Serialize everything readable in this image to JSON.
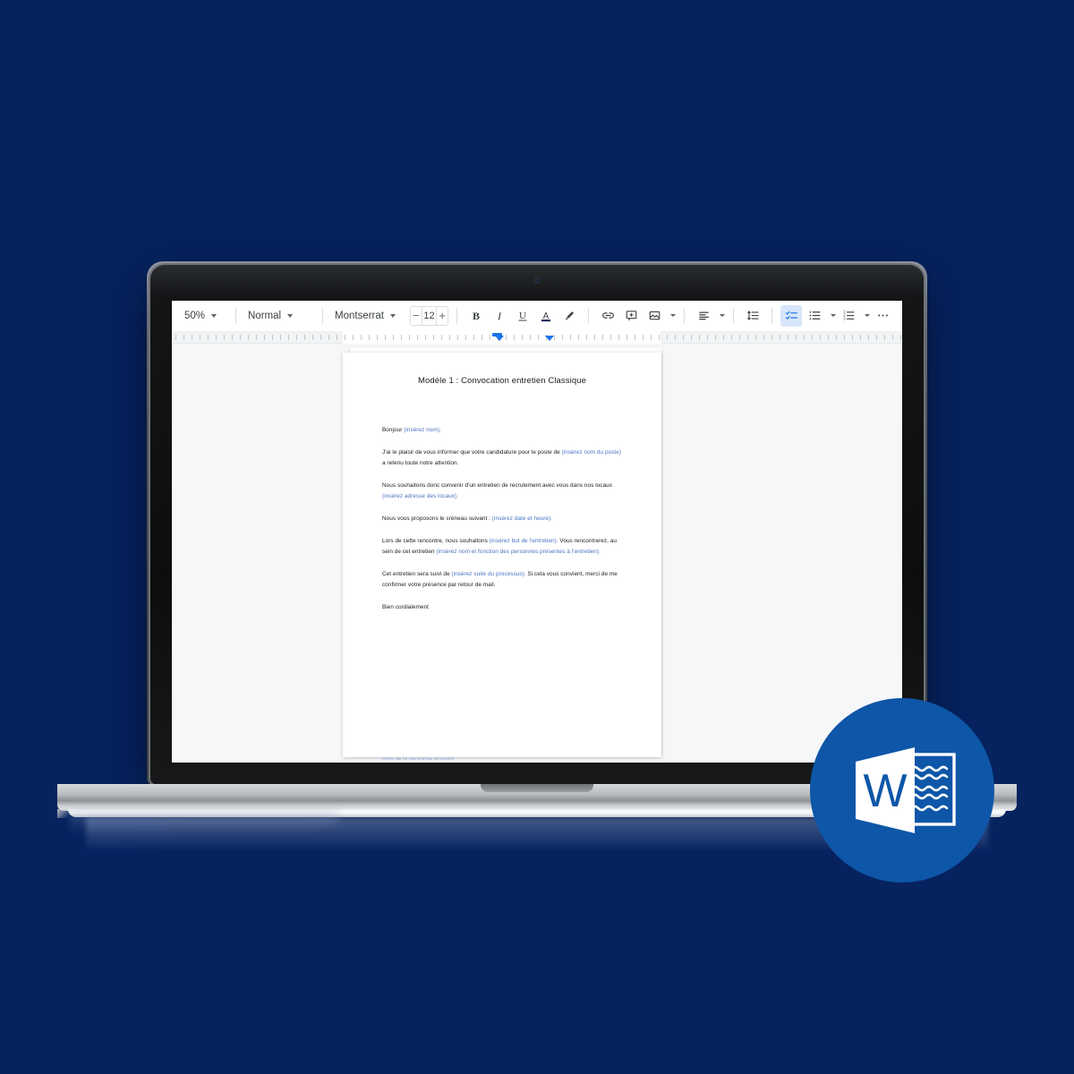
{
  "theme": {
    "background_color": "#06225f",
    "badge_color": "#0e56a8",
    "accent_color": "#1a73e8",
    "placeholder_text_color": "#4a72c4"
  },
  "device": {
    "name": "laptop-mockup",
    "webcam": "webcam-icon"
  },
  "toolbar": {
    "zoom_level": "50%",
    "paragraph_style": "Normal",
    "font_family": "Montserrat",
    "font_size": "12",
    "decrease_size_label": "−",
    "increase_size_label": "+",
    "buttons": [
      {
        "name": "bold-button",
        "label": "B"
      },
      {
        "name": "italic-button",
        "label": "I"
      },
      {
        "name": "underline-button",
        "label": "U"
      },
      {
        "name": "text-color-button",
        "label": "A"
      },
      {
        "name": "highlight-color-button",
        "label": "pen-icon"
      },
      {
        "name": "insert-link-button",
        "label": "link-icon"
      },
      {
        "name": "insert-comment-button",
        "label": "comment-icon"
      },
      {
        "name": "insert-image-button",
        "label": "image-icon"
      },
      {
        "name": "align-button",
        "label": "align-left-icon"
      },
      {
        "name": "line-spacing-button",
        "label": "line-spacing-icon"
      },
      {
        "name": "checklist-button",
        "label": "checklist-icon"
      },
      {
        "name": "bulleted-list-button",
        "label": "bulleted-list-icon"
      },
      {
        "name": "numbered-list-button",
        "label": "numbered-list-icon"
      },
      {
        "name": "more-options-button",
        "label": "…"
      }
    ],
    "checklist_active": true
  },
  "document": {
    "title": "Modèle 1 : Convocation entretien Classique",
    "paragraphs": [
      {
        "id": "greeting",
        "runs": [
          {
            "text": "Bonjour ",
            "placeholder": false
          },
          {
            "text": "(insérez nom),",
            "placeholder": true
          }
        ]
      },
      {
        "id": "intro",
        "runs": [
          {
            "text": "J'ai le plaisir de vous informer que votre candidature pour le poste de ",
            "placeholder": false
          },
          {
            "text": "(insérez nom du poste)",
            "placeholder": true
          },
          {
            "text": " a retenu toute notre attention.",
            "placeholder": false
          }
        ]
      },
      {
        "id": "meeting-location",
        "runs": [
          {
            "text": "Nous souhaitons donc convenir d'un entretien de recrutement avec vous dans nos locaux ",
            "placeholder": false
          },
          {
            "text": "(insérez adresse des locaux).",
            "placeholder": true
          }
        ]
      },
      {
        "id": "time-slot",
        "runs": [
          {
            "text": "Nous vous proposons le créneau suivant : ",
            "placeholder": false
          },
          {
            "text": "(insérez date et heure).",
            "placeholder": true
          }
        ]
      },
      {
        "id": "purpose",
        "runs": [
          {
            "text": "Lors de cette rencontre, nous souhaitons ",
            "placeholder": false
          },
          {
            "text": "(insérez but de l'entretien).",
            "placeholder": true
          },
          {
            "text": " Vous rencontrerez, au sein de cet entretien ",
            "placeholder": false
          },
          {
            "text": "(insérez nom et fonction des personnes présentes à l'entretien).",
            "placeholder": true
          }
        ]
      },
      {
        "id": "next-steps",
        "runs": [
          {
            "text": "Cet entretien sera suivi de ",
            "placeholder": false
          },
          {
            "text": "(insérez suite du processus).",
            "placeholder": true
          },
          {
            "text": " Si cela vous convient, merci de me confirmer votre présence par retour de mail.",
            "placeholder": false
          }
        ]
      },
      {
        "id": "closing",
        "runs": [
          {
            "text": "Bien cordialement",
            "placeholder": false
          }
        ]
      }
    ],
    "footer_clipped_text": "nom de la personne écrivant :"
  },
  "badge": {
    "name": "microsoft-word-logo",
    "letter": "W"
  }
}
